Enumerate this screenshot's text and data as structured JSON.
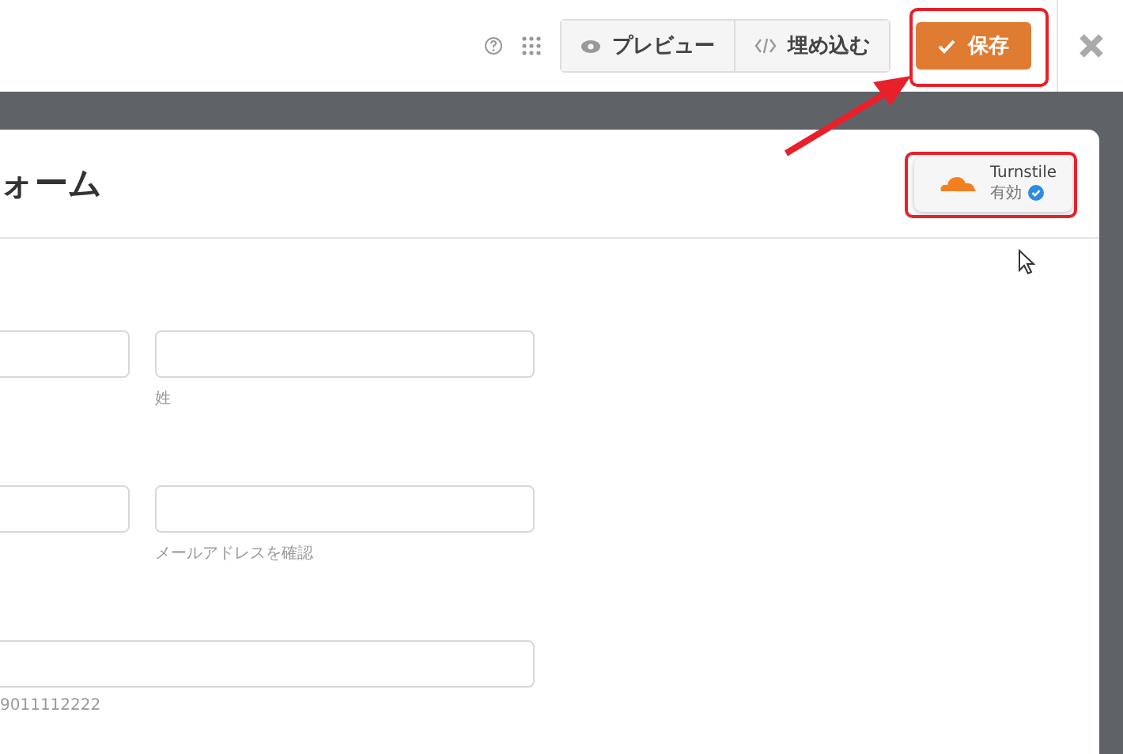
{
  "toolbar": {
    "buttons": [
      {
        "kind": "preview",
        "label": "プレビュー"
      },
      {
        "kind": "embed",
        "label": "埋め込む"
      }
    ],
    "save": {
      "label": "保存"
    }
  },
  "form": {
    "title": "ォーム",
    "turnstile": {
      "name": "Turnstile",
      "status": "有効"
    },
    "rows": [
      {
        "fields": [
          {
            "kind": "half"
          },
          {
            "kind": "half",
            "sublabel": "姓"
          }
        ]
      },
      {
        "fields": [
          {
            "kind": "half"
          },
          {
            "kind": "half",
            "sublabel": "メールアドレスを確認"
          }
        ]
      },
      {
        "fields": [
          {
            "kind": "full",
            "sublabel": "9011112222"
          }
        ]
      }
    ]
  }
}
